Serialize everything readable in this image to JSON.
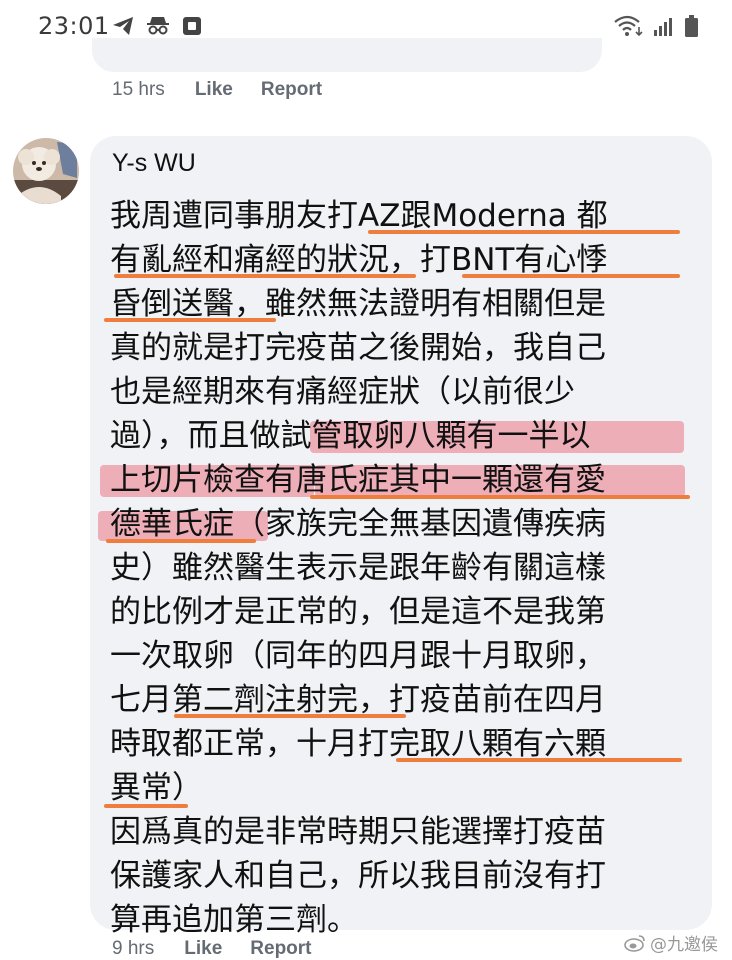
{
  "status_bar": {
    "time": "23:01",
    "left_icons": [
      "telegram-icon",
      "spy-icon",
      "screenshot-icon"
    ],
    "right_icons": [
      "wifi-icon",
      "signal-icon",
      "battery-icon"
    ]
  },
  "previous_comment": {
    "time": "15 hrs",
    "like_label": "Like",
    "report_label": "Report"
  },
  "comment": {
    "author": "Y-s WU",
    "lines": [
      "我周遭同事朋友打AZ跟Moderna 都",
      "有亂經和痛經的狀況，打BNT有心悸",
      "昏倒送醫，雖然無法證明有相關但是",
      "真的就是打完疫苗之後開始，我自己",
      "也是經期來有痛經症狀（以前很少",
      "過），而且做試管取卵八顆有一半以",
      "上切片檢查有唐氏症其中一顆還有愛",
      "德華氏症（家族完全無基因遺傳疾病",
      "史）雖然醫生表示是跟年齡有關這樣",
      "的比例才是正常的，但是這不是我第",
      "一次取卵（同年的四月跟十月取卵，",
      "七月第二劑注射完，打疫苗前在四月",
      "時取都正常，十月打完取八顆有六顆",
      "異常）",
      "因爲真的是非常時期只能選擇打疫苗",
      "保護家人和自己，所以我目前沒有打",
      "算再追加第三劑。"
    ],
    "time": "9 hrs",
    "like_label": "Like",
    "report_label": "Report"
  },
  "annotation_color": "#ee7d3e",
  "highlight_color": "#ec5c6e",
  "watermark": "@九邀侯"
}
